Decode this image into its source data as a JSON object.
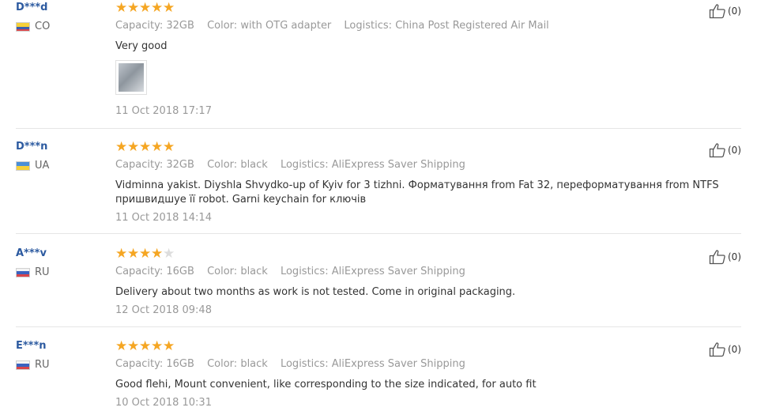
{
  "labels": {
    "capacity": "Capacity:",
    "color": "Color:",
    "logistics": "Logistics:"
  },
  "reviews": [
    {
      "user": "D***d",
      "country": "CO",
      "rating": 5,
      "capacity": "32GB",
      "color": "with OTG adapter",
      "logistics": "China Post Registered Air Mail",
      "text": "Very good",
      "has_photo": true,
      "date": "11 Oct 2018 17:17",
      "likes": "(0)"
    },
    {
      "user": "D***n",
      "country": "UA",
      "rating": 5,
      "capacity": "32GB",
      "color": "black",
      "logistics": "AliExpress Saver Shipping",
      "text": "Vidminna yakist. Diyshla Shvydko-up of Kyiv for 3 tizhni. Форматування from Fat 32, переформатування from NTFS пришвидшуе її robot. Garni keychain for ключів",
      "has_photo": false,
      "date": "11 Oct 2018 14:14",
      "likes": "(0)"
    },
    {
      "user": "A***v",
      "country": "RU",
      "rating": 4,
      "capacity": "16GB",
      "color": "black",
      "logistics": "AliExpress Saver Shipping",
      "text": "Delivery about two months as work is not tested. Come in original packaging.",
      "has_photo": false,
      "date": "12 Oct 2018 09:48",
      "likes": "(0)"
    },
    {
      "user": "E***n",
      "country": "RU",
      "rating": 5,
      "capacity": "16GB",
      "color": "black",
      "logistics": "AliExpress Saver Shipping",
      "text": "Good flehi, Mount convenient, like corresponding to the size indicated, for auto fit",
      "has_photo": false,
      "date": "10 Oct 2018 10:31",
      "likes": "(0)"
    }
  ],
  "colors": {
    "username": "#2c5aa0",
    "star_filled": "#f5a623",
    "star_empty": "#dddddd",
    "muted": "#999999",
    "divider": "#e6e6e6"
  },
  "icons": {
    "like": "thumbs-up-icon",
    "star": "star-icon"
  }
}
